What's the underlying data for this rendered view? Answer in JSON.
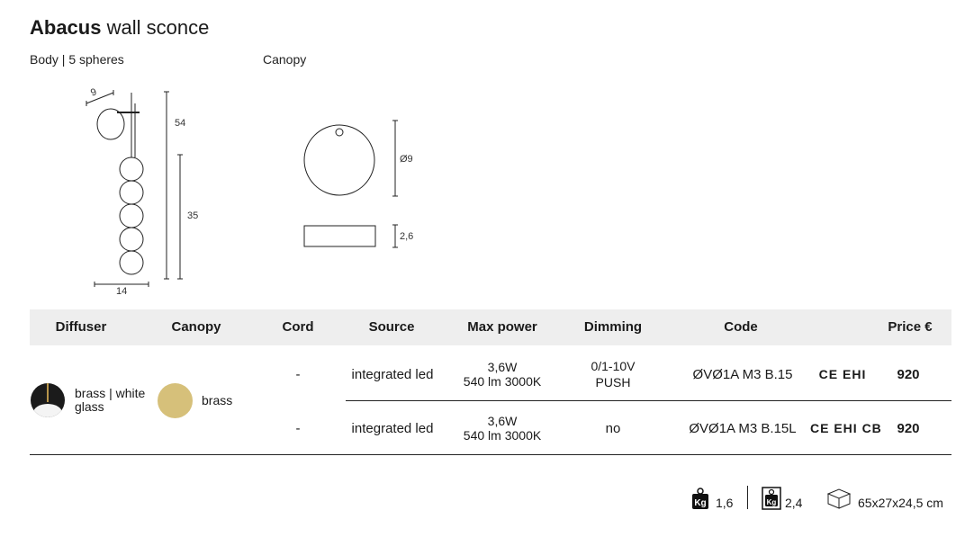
{
  "title": {
    "bold": "Abacus",
    "rest": "wall sconce"
  },
  "drawings": {
    "body_label": "Body | 5 spheres",
    "canopy_label": "Canopy",
    "body_dims": {
      "depth": "9",
      "height": "54",
      "spheres_height": "35",
      "width": "14"
    },
    "canopy_dims": {
      "diameter": "Ø9",
      "thickness": "2,6"
    }
  },
  "table": {
    "headers": [
      "Diffuser",
      "Canopy",
      "Cord",
      "Source",
      "Max power",
      "Dimming",
      "Code",
      "Price €"
    ],
    "diffuser": {
      "label": "brass | white glass"
    },
    "canopy": {
      "label": "brass",
      "color": "#d6c07a"
    },
    "rows": [
      {
        "cord": "-",
        "source": "integrated led",
        "power_w": "3,6W",
        "power_lm": "540 lm 3000K",
        "dimming_1": "0/1-10V",
        "dimming_2": "PUSH",
        "code": "ØVØ1A M3 B.15",
        "certs": "CE EHI",
        "price": "920"
      },
      {
        "cord": "-",
        "source": "integrated led",
        "power_w": "3,6W",
        "power_lm": "540 lm 3000K",
        "dimming_1": "no",
        "dimming_2": "",
        "code": "ØVØ1A M3 B.15L",
        "certs": "CE EHI CB",
        "price": "920"
      }
    ]
  },
  "footer": {
    "net_weight": "1,6",
    "gross_weight": "2,4",
    "package": "65x27x24,5 cm",
    "icons": [
      "weight-icon",
      "weight-icon",
      "box-icon"
    ]
  }
}
